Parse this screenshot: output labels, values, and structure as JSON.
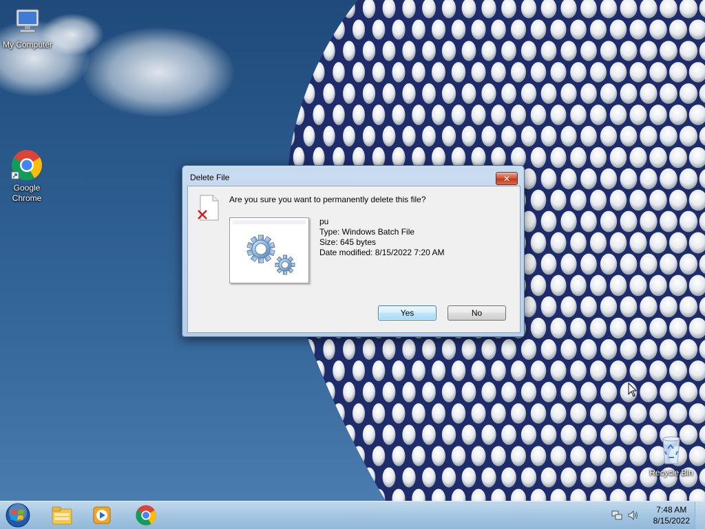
{
  "desktop": {
    "icons": [
      {
        "label": "My Computer",
        "icon": "computer-icon"
      },
      {
        "label": "Google Chrome",
        "line1": "Google",
        "line2": "Chrome",
        "icon": "chrome-icon"
      },
      {
        "label": "Recycle Bin",
        "icon": "recycle-bin-icon"
      }
    ]
  },
  "dialog": {
    "title": "Delete File",
    "close_label": "✕",
    "question": "Are you sure you want to permanently delete this file?",
    "file": {
      "name": "pu",
      "type": "Type: Windows Batch File",
      "size": "Size: 645 bytes",
      "modified": "Date modified: 8/15/2022 7:20 AM"
    },
    "yes_label": "Yes",
    "no_label": "No"
  },
  "taskbar": {
    "items": [
      "start-orb",
      "windows-explorer-icon",
      "media-player-icon",
      "chrome-icon"
    ],
    "clock": {
      "time": "7:48 AM",
      "date": "8/15/2022"
    },
    "tray_icons": [
      "network-icon",
      "volume-icon"
    ]
  },
  "colors": {
    "sky": "#2c5c8f",
    "taskbar": "#a8c8e4",
    "dialog_frame": "#b6cde8",
    "close_button": "#c0391f"
  }
}
